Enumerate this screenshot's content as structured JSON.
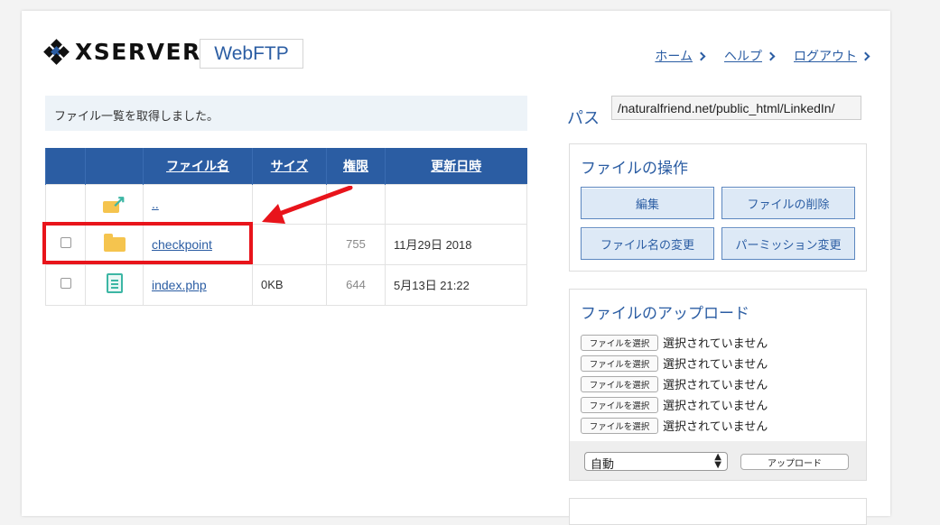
{
  "header": {
    "logo_text": "XSERVER",
    "product": "WebFTP",
    "nav": [
      "ホーム",
      "ヘルプ",
      "ログアウト"
    ]
  },
  "message": "ファイル一覧を取得しました。",
  "table": {
    "headers": [
      "ファイル名",
      "サイズ",
      "権限",
      "更新日時"
    ],
    "rows": [
      {
        "name": "..",
        "size": "",
        "perm": "",
        "date": "",
        "icon": "parent-folder-icon"
      },
      {
        "name": "checkpoint",
        "size": "",
        "perm": "755",
        "date": "11月29日 2018",
        "icon": "folder-icon"
      },
      {
        "name": "index.php",
        "size": "0KB",
        "perm": "644",
        "date": "5月13日 21:22",
        "icon": "document-icon"
      }
    ]
  },
  "path": {
    "label": "パス",
    "value": "/naturalfriend.net/public_html/LinkedIn/"
  },
  "operations": {
    "title": "ファイルの操作",
    "buttons": [
      "編集",
      "ファイルの削除",
      "ファイル名の変更",
      "パーミッション変更"
    ]
  },
  "upload": {
    "title": "ファイルのアップロード",
    "file_button": "ファイルを選択",
    "no_file": "選択されていません",
    "mode": "自動",
    "submit": "アップロード"
  },
  "colors": {
    "accent": "#2b5da3",
    "annotation": "#e8141b",
    "folder": "#f5c44e"
  }
}
